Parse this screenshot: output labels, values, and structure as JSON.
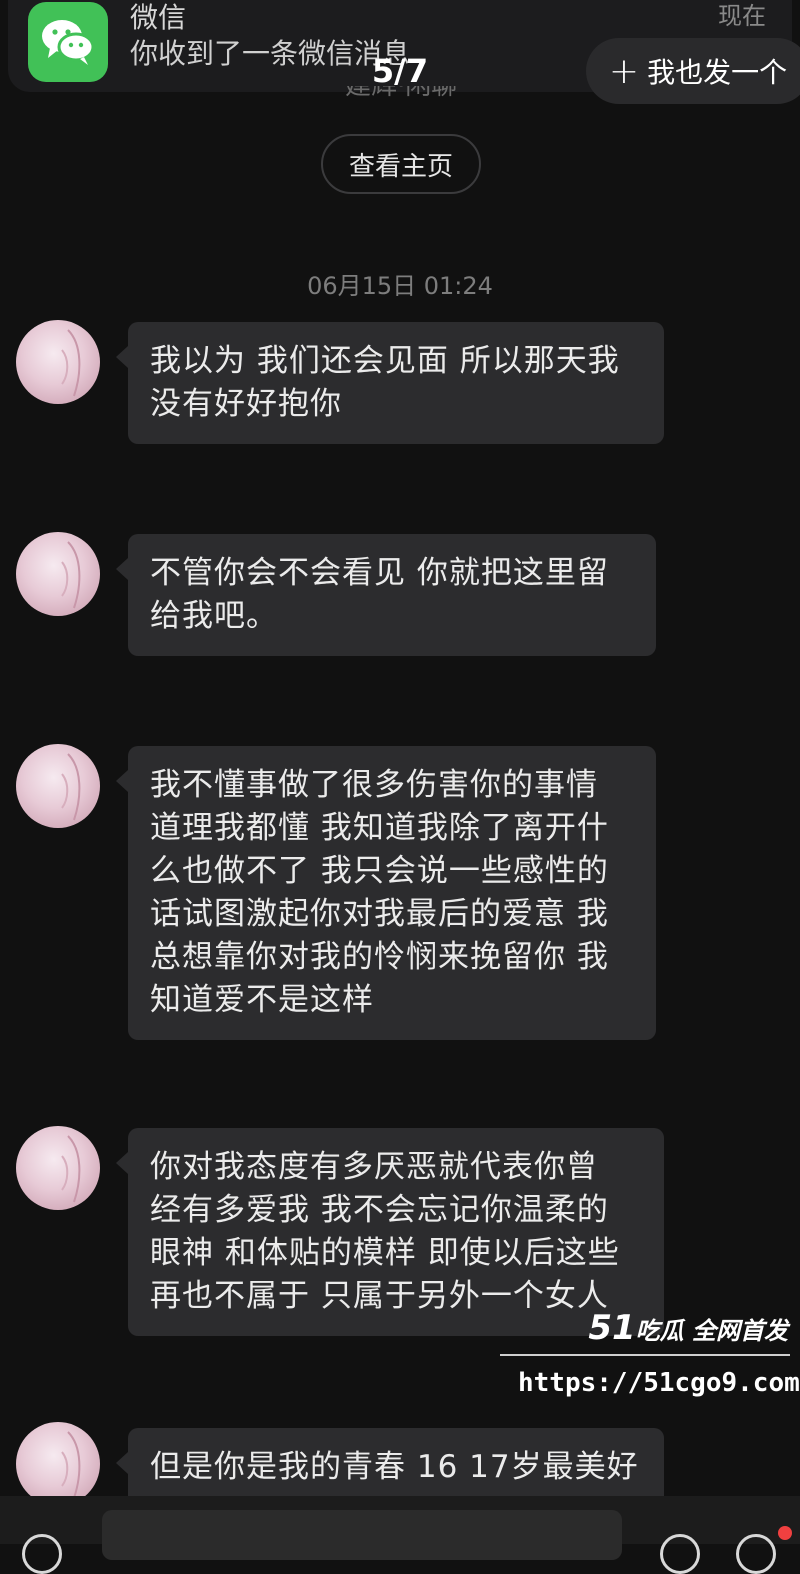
{
  "notification": {
    "app": "微信",
    "message": "你收到了一条微信消息",
    "time": "现在"
  },
  "page_counter": "5/7",
  "add_button": {
    "icon": "plus-icon",
    "label": "我也发一个"
  },
  "cut_text": "建辉·闲聊",
  "home_button": "查看主页",
  "timestamp": "06月15日 01:24",
  "messages": [
    {
      "lines": [
        "我以为 我们还会见面 所以那天我",
        "没有好好抱你"
      ]
    },
    {
      "lines": [
        "不管你会不会看见 你就把这里留",
        "给我吧。"
      ]
    },
    {
      "lines": [
        "我不懂事做了很多伤害你的事情",
        "道理我都懂 我知道我除了离开什",
        "么也做不了 我只会说一些感性的",
        "话试图激起你对我最后的爱意 我",
        "总想靠你对我的怜悯来挽留你 我",
        "知道爱不是这样"
      ]
    },
    {
      "lines": [
        "你对我态度有多厌恶就代表你曾",
        "经有多爱我 我不会忘记你温柔的",
        "眼神 和体贴的模样 即使以后这些",
        "再也不属于 只属于另外一个女人"
      ]
    },
    {
      "lines": [
        "但是你是我的青春 16 17岁最美好"
      ]
    }
  ],
  "watermark": {
    "brand_num": "51",
    "brand_text": "吃瓜 全网首发",
    "url": "https://51cgo9.com"
  },
  "colors": {
    "background": "#111111",
    "bubble": "#2c2c2e",
    "wechat_green": "#41c157"
  }
}
